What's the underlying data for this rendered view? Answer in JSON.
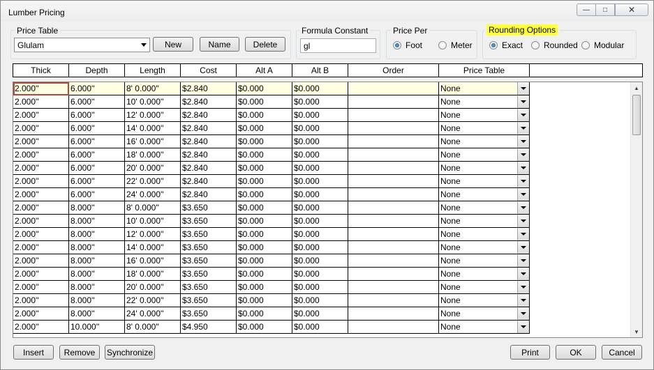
{
  "window": {
    "title": "Lumber Pricing"
  },
  "price_table": {
    "label": "Price Table",
    "selected": "Glulam",
    "new_label": "New",
    "name_label": "Name",
    "delete_label": "Delete"
  },
  "formula": {
    "label": "Formula Constant",
    "value": "gl"
  },
  "price_per": {
    "label": "Price Per",
    "options": [
      "Foot",
      "Meter"
    ],
    "selected": "Foot"
  },
  "rounding": {
    "label": "Rounding Options",
    "options": [
      "Exact",
      "Rounded",
      "Modular"
    ],
    "selected": "Exact",
    "highlight_color": "#ffff3a"
  },
  "table": {
    "columns": [
      "Thick",
      "Depth",
      "Length",
      "Cost",
      "Alt A",
      "Alt B",
      "Order",
      "Price Table"
    ],
    "rows": [
      [
        "2.000''",
        "6.000''",
        "8' 0.000''",
        "$2.840",
        "$0.000",
        "$0.000",
        "",
        "None"
      ],
      [
        "2.000''",
        "6.000''",
        "10' 0.000''",
        "$2.840",
        "$0.000",
        "$0.000",
        "",
        "None"
      ],
      [
        "2.000''",
        "6.000''",
        "12' 0.000''",
        "$2.840",
        "$0.000",
        "$0.000",
        "",
        "None"
      ],
      [
        "2.000''",
        "6.000''",
        "14' 0.000''",
        "$2.840",
        "$0.000",
        "$0.000",
        "",
        "None"
      ],
      [
        "2.000''",
        "6.000''",
        "16' 0.000''",
        "$2.840",
        "$0.000",
        "$0.000",
        "",
        "None"
      ],
      [
        "2.000''",
        "6.000''",
        "18' 0.000''",
        "$2.840",
        "$0.000",
        "$0.000",
        "",
        "None"
      ],
      [
        "2.000''",
        "6.000''",
        "20' 0.000''",
        "$2.840",
        "$0.000",
        "$0.000",
        "",
        "None"
      ],
      [
        "2.000''",
        "6.000''",
        "22' 0.000''",
        "$2.840",
        "$0.000",
        "$0.000",
        "",
        "None"
      ],
      [
        "2.000''",
        "6.000''",
        "24' 0.000''",
        "$2.840",
        "$0.000",
        "$0.000",
        "",
        "None"
      ],
      [
        "2.000''",
        "8.000''",
        "8' 0.000''",
        "$3.650",
        "$0.000",
        "$0.000",
        "",
        "None"
      ],
      [
        "2.000''",
        "8.000''",
        "10' 0.000''",
        "$3.650",
        "$0.000",
        "$0.000",
        "",
        "None"
      ],
      [
        "2.000''",
        "8.000''",
        "12' 0.000''",
        "$3.650",
        "$0.000",
        "$0.000",
        "",
        "None"
      ],
      [
        "2.000''",
        "8.000''",
        "14' 0.000''",
        "$3.650",
        "$0.000",
        "$0.000",
        "",
        "None"
      ],
      [
        "2.000''",
        "8.000''",
        "16' 0.000''",
        "$3.650",
        "$0.000",
        "$0.000",
        "",
        "None"
      ],
      [
        "2.000''",
        "8.000''",
        "18' 0.000''",
        "$3.650",
        "$0.000",
        "$0.000",
        "",
        "None"
      ],
      [
        "2.000''",
        "8.000''",
        "20' 0.000''",
        "$3.650",
        "$0.000",
        "$0.000",
        "",
        "None"
      ],
      [
        "2.000''",
        "8.000''",
        "22' 0.000''",
        "$3.650",
        "$0.000",
        "$0.000",
        "",
        "None"
      ],
      [
        "2.000''",
        "8.000''",
        "24' 0.000''",
        "$3.650",
        "$0.000",
        "$0.000",
        "",
        "None"
      ],
      [
        "2.000''",
        "10.000''",
        "8' 0.000''",
        "$4.950",
        "$0.000",
        "$0.000",
        "",
        "None"
      ]
    ]
  },
  "footer": {
    "insert_label": "Insert",
    "remove_label": "Remove",
    "synchronize_label": "Synchronize",
    "print_label": "Print",
    "ok_label": "OK",
    "cancel_label": "Cancel"
  }
}
